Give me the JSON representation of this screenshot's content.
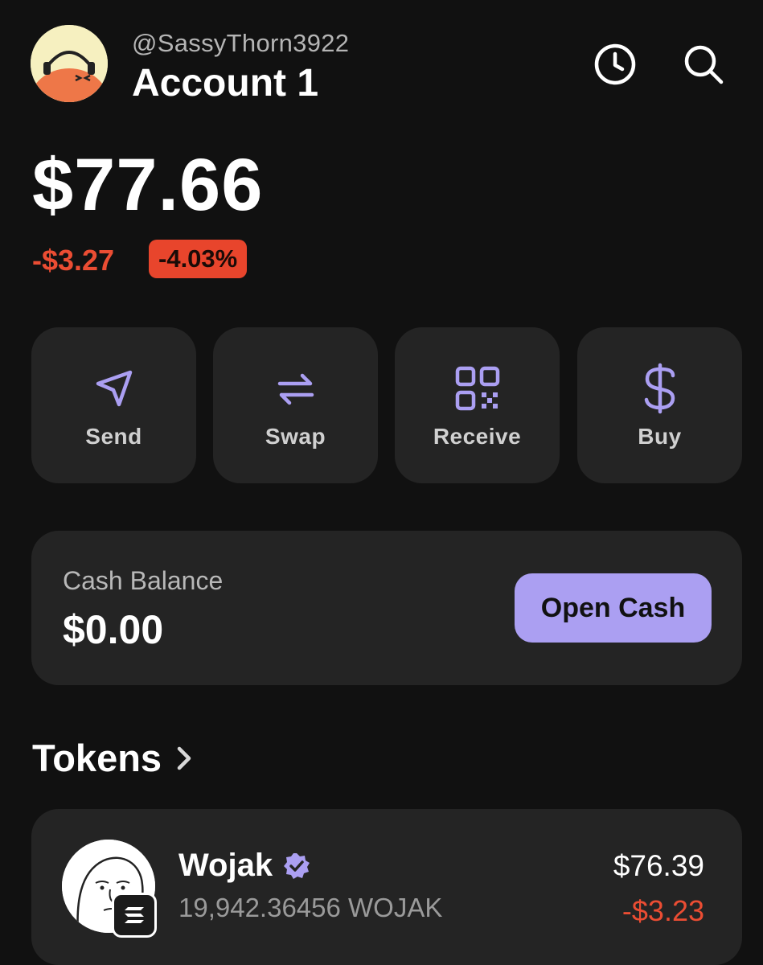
{
  "header": {
    "handle": "@SassyThorn3922",
    "account_name": "Account 1",
    "icons": [
      "history-icon",
      "search-icon"
    ]
  },
  "portfolio": {
    "balance": "$77.66",
    "change_amount": "-$3.27",
    "change_percent": "-4.03%"
  },
  "actions": [
    {
      "label": "Send",
      "icon": "send-icon"
    },
    {
      "label": "Swap",
      "icon": "swap-icon"
    },
    {
      "label": "Receive",
      "icon": "qr-code-icon"
    },
    {
      "label": "Buy",
      "icon": "dollar-icon"
    }
  ],
  "cash": {
    "label": "Cash Balance",
    "value": "$0.00",
    "button_label": "Open Cash"
  },
  "tokens": {
    "title": "Tokens",
    "items": [
      {
        "name": "Wojak",
        "verified": true,
        "amount": "19,942.36456 WOJAK",
        "value": "$76.39",
        "change": "-$3.23"
      }
    ]
  },
  "colors": {
    "background": "#111111",
    "card": "#242424",
    "accent": "#ab9ff2",
    "negative": "#eb4d33"
  }
}
